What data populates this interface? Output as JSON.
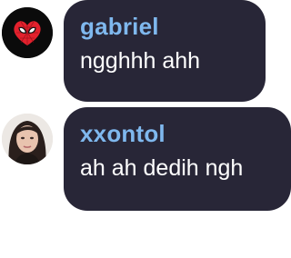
{
  "messages": [
    {
      "author": "gabriel",
      "text": "ngghhh ahh",
      "avatar_icon": "spider-mask-heart-icon",
      "name_color": "#7fb8ee"
    },
    {
      "author": "xxontol",
      "text": "ah ah dedih ngh",
      "avatar_icon": "portrait-photo",
      "name_color": "#7fb8ee"
    }
  ],
  "colors": {
    "bubble_bg": "#282637",
    "text": "#ffffff",
    "page_bg": "#ffffff"
  }
}
